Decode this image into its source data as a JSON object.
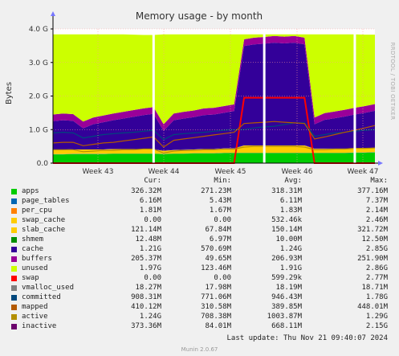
{
  "chart_data": {
    "type": "area",
    "title": "Memory usage - by month",
    "ylabel": "Bytes",
    "ylim": [
      0,
      4.0
    ],
    "y_unit": "G",
    "yticks": [
      "0.0",
      "1.0 G",
      "2.0 G",
      "3.0 G",
      "4.0 G"
    ],
    "x": [
      0,
      1,
      2,
      3,
      4,
      5,
      6,
      7,
      8,
      9,
      10,
      11,
      12,
      13,
      14,
      15,
      16,
      17,
      18,
      19,
      20,
      21,
      22,
      23,
      24,
      25,
      26,
      27,
      28,
      29,
      30,
      31,
      32
    ],
    "week_labels": [
      "Week 43",
      "Week 44",
      "Week 45",
      "Week 46",
      "Week 47"
    ],
    "gaps": [
      10,
      21,
      30
    ],
    "series": [
      {
        "name": "apps",
        "color": "#00cc00",
        "values": [
          0.26,
          0.26,
          0.27,
          0.27,
          0.27,
          0.27,
          0.28,
          0.28,
          0.28,
          0.28,
          0.28,
          0.27,
          0.28,
          0.28,
          0.29,
          0.29,
          0.29,
          0.3,
          0.3,
          0.3,
          0.3,
          0.3,
          0.3,
          0.3,
          0.3,
          0.3,
          0.3,
          0.3,
          0.3,
          0.3,
          0.31,
          0.31,
          0.32
        ]
      },
      {
        "name": "page_tables",
        "color": "#0066b3",
        "values": [
          0.006,
          0.006,
          0.006,
          0.006,
          0.006,
          0.006,
          0.006,
          0.006,
          0.006,
          0.006,
          0.006,
          0.006,
          0.006,
          0.006,
          0.006,
          0.006,
          0.006,
          0.006,
          0.006,
          0.006,
          0.006,
          0.006,
          0.006,
          0.006,
          0.006,
          0.006,
          0.006,
          0.006,
          0.006,
          0.006,
          0.006,
          0.006,
          0.006
        ]
      },
      {
        "name": "per_cpu",
        "color": "#ff8000",
        "values": [
          0.002,
          0.002,
          0.002,
          0.002,
          0.002,
          0.002,
          0.002,
          0.002,
          0.002,
          0.002,
          0.002,
          0.002,
          0.002,
          0.002,
          0.002,
          0.002,
          0.002,
          0.002,
          0.002,
          0.002,
          0.002,
          0.002,
          0.002,
          0.002,
          0.002,
          0.002,
          0.002,
          0.002,
          0.002,
          0.002,
          0.002,
          0.002,
          0.002
        ]
      },
      {
        "name": "swap_cache",
        "color": "#ffcc00",
        "values": [
          0,
          0,
          0,
          0,
          0,
          0,
          0,
          0,
          0,
          0,
          0,
          0,
          0,
          0,
          0,
          0,
          0,
          0,
          0,
          0,
          0,
          0,
          0,
          0,
          0,
          0,
          0,
          0,
          0,
          0,
          0,
          0,
          0
        ]
      },
      {
        "name": "slab_cache",
        "color": "#ffcc00",
        "values": [
          0.12,
          0.12,
          0.13,
          0.13,
          0.13,
          0.13,
          0.13,
          0.13,
          0.13,
          0.13,
          0.12,
          0.09,
          0.1,
          0.11,
          0.11,
          0.12,
          0.12,
          0.13,
          0.13,
          0.22,
          0.22,
          0.22,
          0.22,
          0.22,
          0.22,
          0.22,
          0.12,
          0.12,
          0.12,
          0.12,
          0.12,
          0.12,
          0.12
        ]
      },
      {
        "name": "shmem",
        "color": "#330099",
        "values": [
          0.012,
          0.012,
          0.012,
          0.012,
          0.012,
          0.012,
          0.012,
          0.012,
          0.012,
          0.012,
          0.012,
          0.012,
          0.012,
          0.012,
          0.012,
          0.012,
          0.012,
          0.012,
          0.012,
          0.012,
          0.012,
          0.012,
          0.012,
          0.012,
          0.012,
          0.012,
          0.012,
          0.012,
          0.012,
          0.012,
          0.012,
          0.012,
          0.012
        ]
      },
      {
        "name": "cache",
        "color": "#330099",
        "values": [
          0.85,
          0.88,
          0.84,
          0.62,
          0.74,
          0.8,
          0.85,
          0.9,
          0.95,
          1.0,
          1.05,
          0.58,
          0.88,
          0.92,
          0.95,
          1.0,
          1.02,
          1.05,
          1.1,
          2.95,
          3.0,
          3.02,
          3.05,
          3.03,
          3.05,
          3.0,
          0.72,
          0.85,
          0.9,
          0.95,
          1.0,
          1.05,
          1.1
        ]
      },
      {
        "name": "buffers",
        "color": "#990099",
        "values": [
          0.2,
          0.2,
          0.2,
          0.2,
          0.2,
          0.2,
          0.2,
          0.2,
          0.2,
          0.2,
          0.2,
          0.2,
          0.2,
          0.2,
          0.2,
          0.2,
          0.2,
          0.2,
          0.2,
          0.2,
          0.2,
          0.2,
          0.2,
          0.2,
          0.2,
          0.2,
          0.2,
          0.2,
          0.2,
          0.2,
          0.2,
          0.2,
          0.2
        ]
      },
      {
        "name": "unused",
        "color": "#ccff00",
        "values": [
          2.4,
          2.37,
          2.4,
          2.63,
          2.5,
          2.43,
          2.37,
          2.31,
          2.25,
          2.19,
          2.15,
          2.73,
          2.39,
          2.33,
          2.29,
          2.22,
          2.2,
          2.16,
          2.1,
          0.15,
          0.1,
          0.08,
          0.05,
          0.07,
          0.05,
          0.1,
          2.5,
          2.36,
          2.3,
          2.25,
          2.19,
          2.13,
          2.07
        ]
      }
    ],
    "lines": [
      {
        "name": "swap",
        "color": "#ff0000",
        "values": [
          0.0,
          0.0,
          0.0,
          0.0,
          0.0,
          0.0,
          0.0,
          0.0,
          0.0,
          0.0,
          0.0,
          0.0,
          0.0,
          0.0,
          0.0,
          0.0,
          0.0,
          0.0,
          0.0,
          1.95,
          1.95,
          1.95,
          1.95,
          1.95,
          1.95,
          1.95,
          0.0,
          0.0,
          0.0,
          0.0,
          0.0,
          0.0,
          0.0
        ]
      },
      {
        "name": "committed",
        "color": "#00487d",
        "values": [
          0.9,
          0.92,
          0.9,
          0.75,
          0.8,
          0.85,
          0.88,
          0.9,
          0.92,
          0.95,
          0.98,
          0.7,
          0.85,
          0.88,
          0.9,
          0.92,
          0.95,
          0.98,
          1.0,
          1.0,
          1.05,
          1.08,
          1.1,
          1.15,
          1.2,
          1.2,
          0.8,
          0.85,
          0.9,
          0.92,
          0.95,
          0.98,
          1.0
        ]
      },
      {
        "name": "inactive",
        "color": "#b35a00",
        "values": [
          0.6,
          0.62,
          0.62,
          0.52,
          0.56,
          0.6,
          0.62,
          0.66,
          0.7,
          0.74,
          0.78,
          0.48,
          0.68,
          0.72,
          0.76,
          0.8,
          0.84,
          0.88,
          0.92,
          1.18,
          1.2,
          1.22,
          1.24,
          1.22,
          1.2,
          1.18,
          0.72,
          0.78,
          0.85,
          0.92,
          0.98,
          1.05,
          1.12
        ]
      },
      {
        "name": "active",
        "color": "#b38f00",
        "values": [
          0.4,
          0.4,
          0.4,
          0.34,
          0.36,
          0.38,
          0.38,
          0.4,
          0.4,
          0.42,
          0.42,
          0.3,
          0.36,
          0.38,
          0.38,
          0.4,
          0.4,
          0.42,
          0.42,
          0.48,
          0.5,
          0.5,
          0.5,
          0.5,
          0.5,
          0.48,
          0.4,
          0.4,
          0.42,
          0.42,
          0.44,
          0.44,
          0.45
        ]
      }
    ]
  },
  "watermark": "RRDTOOL / TOBI OETIKER",
  "legend": {
    "headers": [
      "Cur:",
      "Min:",
      "Avg:",
      "Max:"
    ],
    "rows": [
      {
        "name": "apps",
        "color": "#00cc00",
        "cur": "326.32M",
        "min": "271.23M",
        "avg": "318.31M",
        "max": "377.16M"
      },
      {
        "name": "page_tables",
        "color": "#0066b3",
        "cur": "6.16M",
        "min": "5.43M",
        "avg": "6.11M",
        "max": "7.37M"
      },
      {
        "name": "per_cpu",
        "color": "#ff8000",
        "cur": "1.81M",
        "min": "1.67M",
        "avg": "1.83M",
        "max": "2.14M"
      },
      {
        "name": "swap_cache",
        "color": "#ffcc00",
        "cur": "0.00",
        "min": "0.00",
        "avg": "532.46k",
        "max": "2.46M"
      },
      {
        "name": "slab_cache",
        "color": "#ffcc00",
        "cur": "121.14M",
        "min": "67.84M",
        "avg": "150.14M",
        "max": "321.72M"
      },
      {
        "name": "shmem",
        "color": "#008f00",
        "cur": "12.48M",
        "min": "6.97M",
        "avg": "10.00M",
        "max": "12.50M"
      },
      {
        "name": "cache",
        "color": "#330099",
        "cur": "1.21G",
        "min": "570.69M",
        "avg": "1.24G",
        "max": "2.85G"
      },
      {
        "name": "buffers",
        "color": "#990099",
        "cur": "205.37M",
        "min": "49.65M",
        "avg": "206.93M",
        "max": "251.90M"
      },
      {
        "name": "unused",
        "color": "#ccff00",
        "cur": "1.97G",
        "min": "123.46M",
        "avg": "1.91G",
        "max": "2.86G"
      },
      {
        "name": "swap",
        "color": "#ff0000",
        "cur": "0.00",
        "min": "0.00",
        "avg": "599.29k",
        "max": "2.77M"
      },
      {
        "name": "vmalloc_used",
        "color": "#808080",
        "cur": "18.27M",
        "min": "17.98M",
        "avg": "18.19M",
        "max": "18.71M"
      },
      {
        "name": "committed",
        "color": "#00487d",
        "cur": "908.31M",
        "min": "771.06M",
        "avg": "946.43M",
        "max": "1.78G"
      },
      {
        "name": "mapped",
        "color": "#b35a00",
        "cur": "410.12M",
        "min": "310.58M",
        "avg": "389.85M",
        "max": "448.01M"
      },
      {
        "name": "active",
        "color": "#b38f00",
        "cur": "1.24G",
        "min": "708.38M",
        "avg": "1003.87M",
        "max": "1.29G"
      },
      {
        "name": "inactive",
        "color": "#6b006b",
        "cur": "373.36M",
        "min": "84.01M",
        "avg": "668.11M",
        "max": "2.15G"
      }
    ]
  },
  "footer": "Last update: Thu Nov 21 09:40:07 2024",
  "munin": "Munin 2.0.67"
}
